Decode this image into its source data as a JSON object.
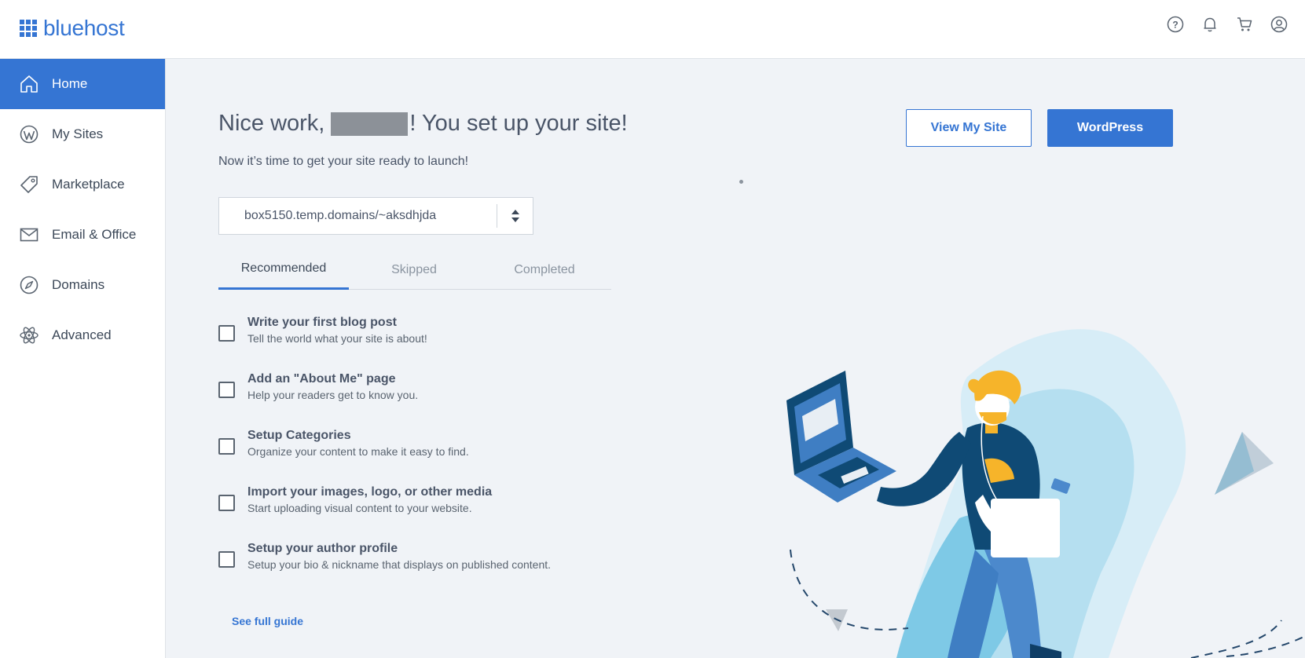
{
  "header": {
    "logo_text": "bluehost",
    "icons": [
      "help-icon",
      "bell-icon",
      "cart-icon",
      "user-icon"
    ]
  },
  "sidebar": {
    "items": [
      {
        "label": "Home",
        "icon": "home-icon",
        "active": true
      },
      {
        "label": "My Sites",
        "icon": "wordpress-icon"
      },
      {
        "label": "Marketplace",
        "icon": "tag-icon"
      },
      {
        "label": "Email & Office",
        "icon": "envelope-icon"
      },
      {
        "label": "Domains",
        "icon": "compass-icon"
      },
      {
        "label": "Advanced",
        "icon": "atom-icon"
      }
    ]
  },
  "main": {
    "title_prefix": "Nice work,",
    "title_suffix": "! You set up your site!",
    "subtitle": "Now it’s time to get your site ready to launch!",
    "view_site_label": "View My Site",
    "wordpress_label": "WordPress",
    "site_select_value": "box5150.temp.domains/~aksdhjda",
    "tabs": [
      {
        "label": "Recommended",
        "active": true
      },
      {
        "label": "Skipped"
      },
      {
        "label": "Completed"
      }
    ],
    "tasks": [
      {
        "title": "Write your first blog post",
        "desc": "Tell the world what your site is about!"
      },
      {
        "title": "Add an \"About Me\" page",
        "desc": "Help your readers get to know you."
      },
      {
        "title": "Setup Categories",
        "desc": "Organize your content to make it easy to find."
      },
      {
        "title": "Import your images, logo, or other media",
        "desc": "Start uploading visual content to your website."
      },
      {
        "title": "Setup your author profile",
        "desc": "Setup your bio & nickname that displays on published content."
      }
    ],
    "guide_link": "See full guide"
  },
  "colors": {
    "brand": "#3575d3",
    "background": "#f0f3f7",
    "text": "#4a5568"
  }
}
